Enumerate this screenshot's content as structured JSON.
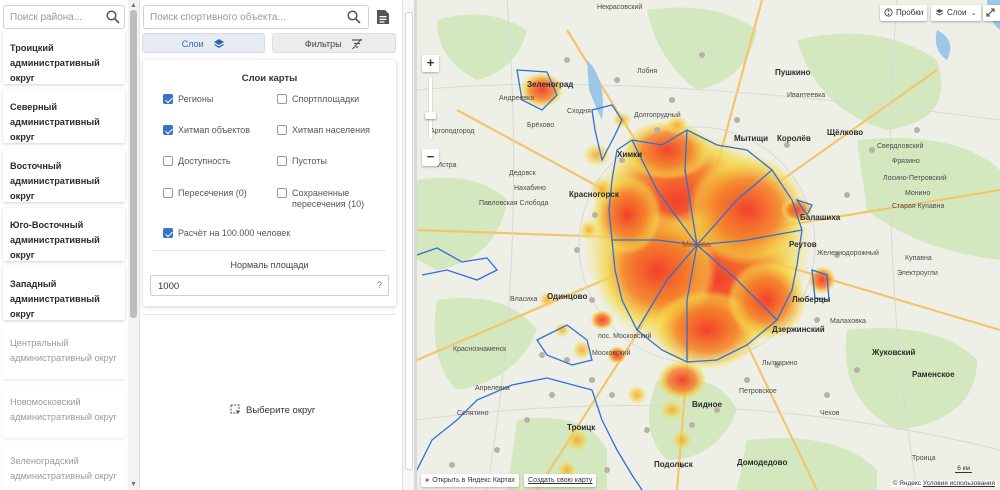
{
  "districts_panel": {
    "search_placeholder": "Поиск района...",
    "items": [
      {
        "label": "Троицкий административный округ",
        "dim": false
      },
      {
        "label": "Северный административный округ",
        "dim": false
      },
      {
        "label": "Восточный административный округ",
        "dim": false
      },
      {
        "label": "Юго-Восточный административный округ",
        "dim": false
      },
      {
        "label": "Западный административный округ",
        "dim": false
      },
      {
        "label": "Центральный административный округ",
        "dim": true
      },
      {
        "label": "Новомосковский административный округ",
        "dim": true
      },
      {
        "label": "Зеленоградский административный округ",
        "dim": true
      }
    ]
  },
  "controls": {
    "object_search_placeholder": "Поиск спортивного объекта...",
    "tab_layers": "Слои",
    "tab_filters": "Фильтры",
    "panel_title": "Слои карты",
    "checkboxes": [
      {
        "label": "Регионы",
        "checked": true
      },
      {
        "label": "Спортплощадки",
        "checked": false
      },
      {
        "label": "Хитмап объектов",
        "checked": true
      },
      {
        "label": "Хитмап населения",
        "checked": false
      },
      {
        "label": "Доступность",
        "checked": false
      },
      {
        "label": "Пустоты",
        "checked": false
      },
      {
        "label": "Пересечения (0)",
        "checked": false
      },
      {
        "label": "Сохраненные пересечения (10)",
        "checked": false
      },
      {
        "label": "Расчёт на 100.000 человек",
        "checked": true
      }
    ],
    "norm_title": "Нормаль площади",
    "norm_value": "1000",
    "norm_help": "?",
    "pick_hint": "Выберите округ"
  },
  "map": {
    "btn_traffic": "Пробки",
    "btn_layers": "Слои",
    "zoom_in": "+",
    "zoom_out": "−",
    "open_in_yandex": "Открыть в Яндекс Картах",
    "create_map": "Создать свою карту",
    "scale": "6 км",
    "copyright": "© Яндекс",
    "terms": "Условия использования",
    "colors": {
      "region_border": "#2f6fd6",
      "heat_core": "#f23b2a",
      "heat_mid": "#f39a28",
      "heat_edge": "#f4de4a",
      "park": "#cfe6b8",
      "road": "#f5c76b"
    },
    "places": [
      {
        "name": "Некрасовский"
      },
      {
        "name": "Зеленоград"
      },
      {
        "name": "Андреевка"
      },
      {
        "name": "Сходня"
      },
      {
        "name": "Брёхово"
      },
      {
        "name": "Лобня"
      },
      {
        "name": "Долгопрудный"
      },
      {
        "name": "Химки"
      },
      {
        "name": "Пушкино"
      },
      {
        "name": "Ивантеевка"
      },
      {
        "name": "Мытищи"
      },
      {
        "name": "Королёв"
      },
      {
        "name": "Щёлково"
      },
      {
        "name": "Свердловский"
      },
      {
        "name": "Фрязино"
      },
      {
        "name": "Лосино-Петровский"
      },
      {
        "name": "Монино"
      },
      {
        "name": "Старая Купавна"
      },
      {
        "name": "Балашиха"
      },
      {
        "name": "Реутов"
      },
      {
        "name": "Железнодорожный"
      },
      {
        "name": "Купавна"
      },
      {
        "name": "Электроугли"
      },
      {
        "name": "Люберцы"
      },
      {
        "name": "Дзержинский"
      },
      {
        "name": "Малаховка"
      },
      {
        "name": "Жуковский"
      },
      {
        "name": "Раменское"
      },
      {
        "name": "Лыткарино"
      },
      {
        "name": "Петровское"
      },
      {
        "name": "Домодедово"
      },
      {
        "name": "Подольск"
      },
      {
        "name": "Видное"
      },
      {
        "name": "Москва"
      },
      {
        "name": "Красногорск"
      },
      {
        "name": "Нахабино"
      },
      {
        "name": "Дедовск"
      },
      {
        "name": "Истра"
      },
      {
        "name": "Одинцово"
      },
      {
        "name": "Власиха"
      },
      {
        "name": "Краснознаменск"
      },
      {
        "name": "Апрелевка"
      },
      {
        "name": "Селятино"
      },
      {
        "name": "Троицк"
      },
      {
        "name": "пос. Московский"
      },
      {
        "name": "Московский"
      },
      {
        "name": "Аргоподгород"
      },
      {
        "name": "Павловская Слобода"
      },
      {
        "name": "Троица"
      },
      {
        "name": "Чехов"
      }
    ]
  }
}
